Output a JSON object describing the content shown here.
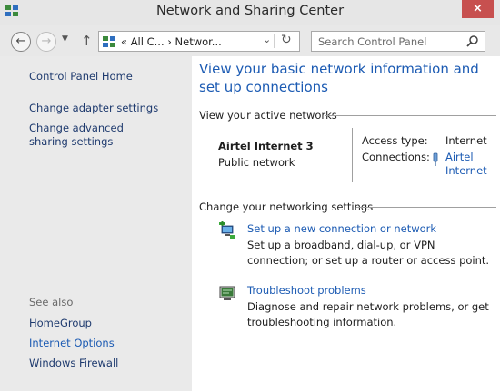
{
  "window": {
    "title": "Network and Sharing Center",
    "close_glyph": "×"
  },
  "nav": {
    "back_glyph": "←",
    "forward_glyph": "→",
    "recent_glyph": "▼",
    "up_glyph": "↑",
    "address_text": "«  All C...  ›  Networ...",
    "address_dropdown_glyph": "⌄",
    "refresh_glyph": "↻",
    "search_placeholder": "Search Control Panel"
  },
  "sidebar": {
    "home": "Control Panel Home",
    "links": [
      "Change adapter settings",
      "Change advanced sharing settings"
    ],
    "see_also_heading": "See also",
    "see_also": [
      "HomeGroup",
      "Internet Options",
      "Windows Firewall"
    ]
  },
  "main": {
    "title": "View your basic network information and set up connections",
    "active_heading": "View your active networks",
    "network": {
      "name": "Airtel Internet  3",
      "type": "Public network",
      "access_label": "Access type:",
      "access_value": "Internet",
      "connections_label": "Connections:",
      "connection_link": "Airtel Internet"
    },
    "change_heading": "Change your networking settings",
    "tasks": [
      {
        "title": "Set up a new connection or network",
        "desc": "Set up a broadband, dial-up, or VPN connection; or set up a router or access point.",
        "icon": "new-connection-icon"
      },
      {
        "title": "Troubleshoot problems",
        "desc": "Diagnose and repair network problems, or get troubleshooting information.",
        "icon": "troubleshoot-icon"
      }
    ]
  },
  "colors": {
    "link": "#1c5bb3",
    "close": "#c7504f",
    "sidebar_bg": "#eaeaea"
  }
}
